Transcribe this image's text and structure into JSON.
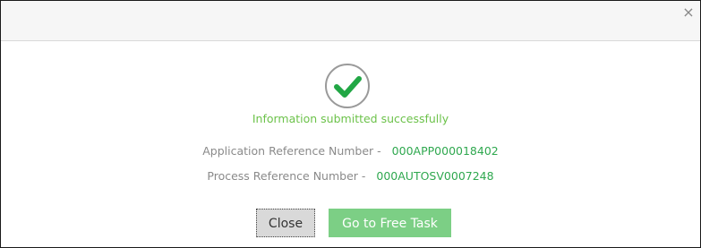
{
  "dialog": {
    "close_icon": "×",
    "success_message": "Information submitted successfully",
    "application_reference": {
      "label": "Application Reference Number -",
      "value": "000APP000018402"
    },
    "process_reference": {
      "label": "Process Reference Number -",
      "value": "000AUTOSV0007248"
    },
    "buttons": {
      "close_label": "Close",
      "free_task_label": "Go to Free Task"
    }
  },
  "colors": {
    "success_green": "#2fa84f",
    "message_green": "#6cc24a",
    "button_green": "#7ccf85",
    "header_bg": "#f6f6f6"
  },
  "icons": {
    "success": "check-circle-icon",
    "close": "close-icon"
  }
}
